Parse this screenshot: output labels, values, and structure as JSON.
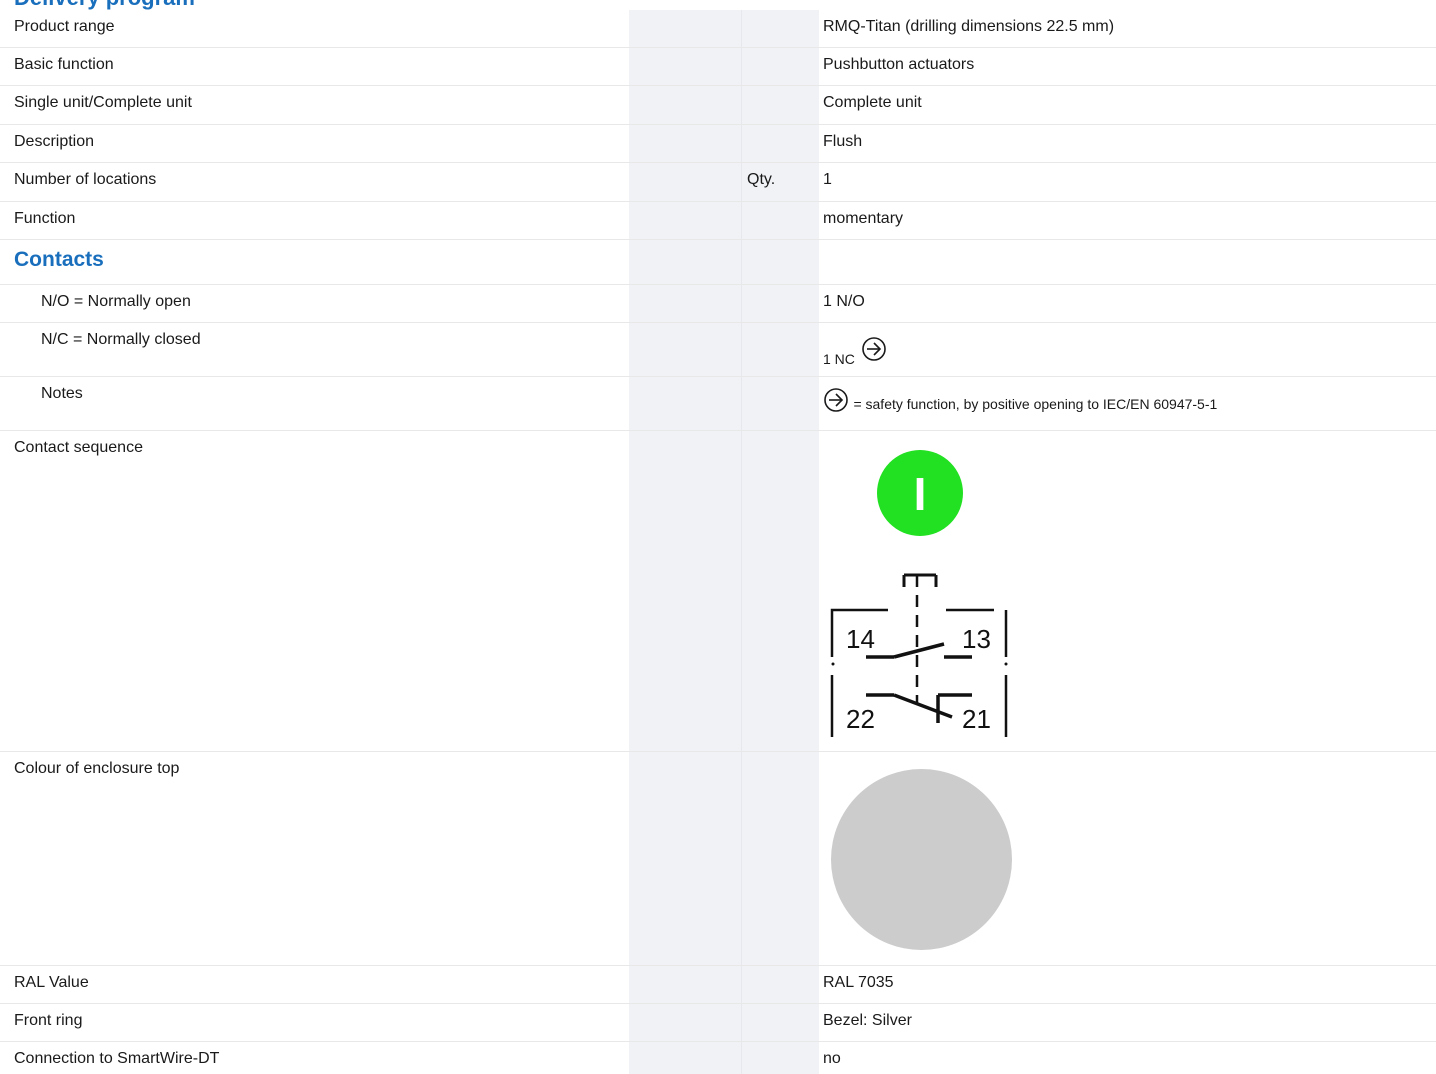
{
  "header": {
    "title": "Delivery program"
  },
  "rows": [
    {
      "label": "Product range",
      "unit": "",
      "value": "RMQ-Titan (drilling dimensions 22.5 mm)"
    },
    {
      "label": "Basic function",
      "unit": "",
      "value": "Pushbutton actuators"
    },
    {
      "label": "Single unit/Complete unit",
      "unit": "",
      "value": "Complete unit"
    },
    {
      "label": "Description",
      "unit": "",
      "value": "Flush"
    },
    {
      "label": "Number of locations",
      "unit": "Qty.",
      "value": "1"
    },
    {
      "label": "Function",
      "unit": "",
      "value": "momentary"
    }
  ],
  "contacts": {
    "heading": "Contacts",
    "no_label": "N/O = Normally open",
    "no_value": "1 N/O",
    "nc_label": "N/C = Normally closed",
    "nc_value": "1 NC",
    "notes_label": "Notes",
    "notes_value": "= safety function, by positive opening to IEC/EN 60947-5-1",
    "positive_opening_icon": "positive-opening-arrow-icon"
  },
  "contact_sequence": {
    "label": "Contact sequence",
    "button_symbol": "I",
    "button_color": "#22e022",
    "terminals": {
      "no_left": "14",
      "no_right": "13",
      "nc_left": "22",
      "nc_right": "21"
    }
  },
  "enclosure": {
    "label": "Colour of enclosure top",
    "color": "#cccccc"
  },
  "bottom_rows": [
    {
      "label": "RAL Value",
      "value": "RAL 7035"
    },
    {
      "label": "Front ring",
      "value": "Bezel: Silver"
    },
    {
      "label": "Connection to SmartWire-DT",
      "value": "no"
    }
  ]
}
